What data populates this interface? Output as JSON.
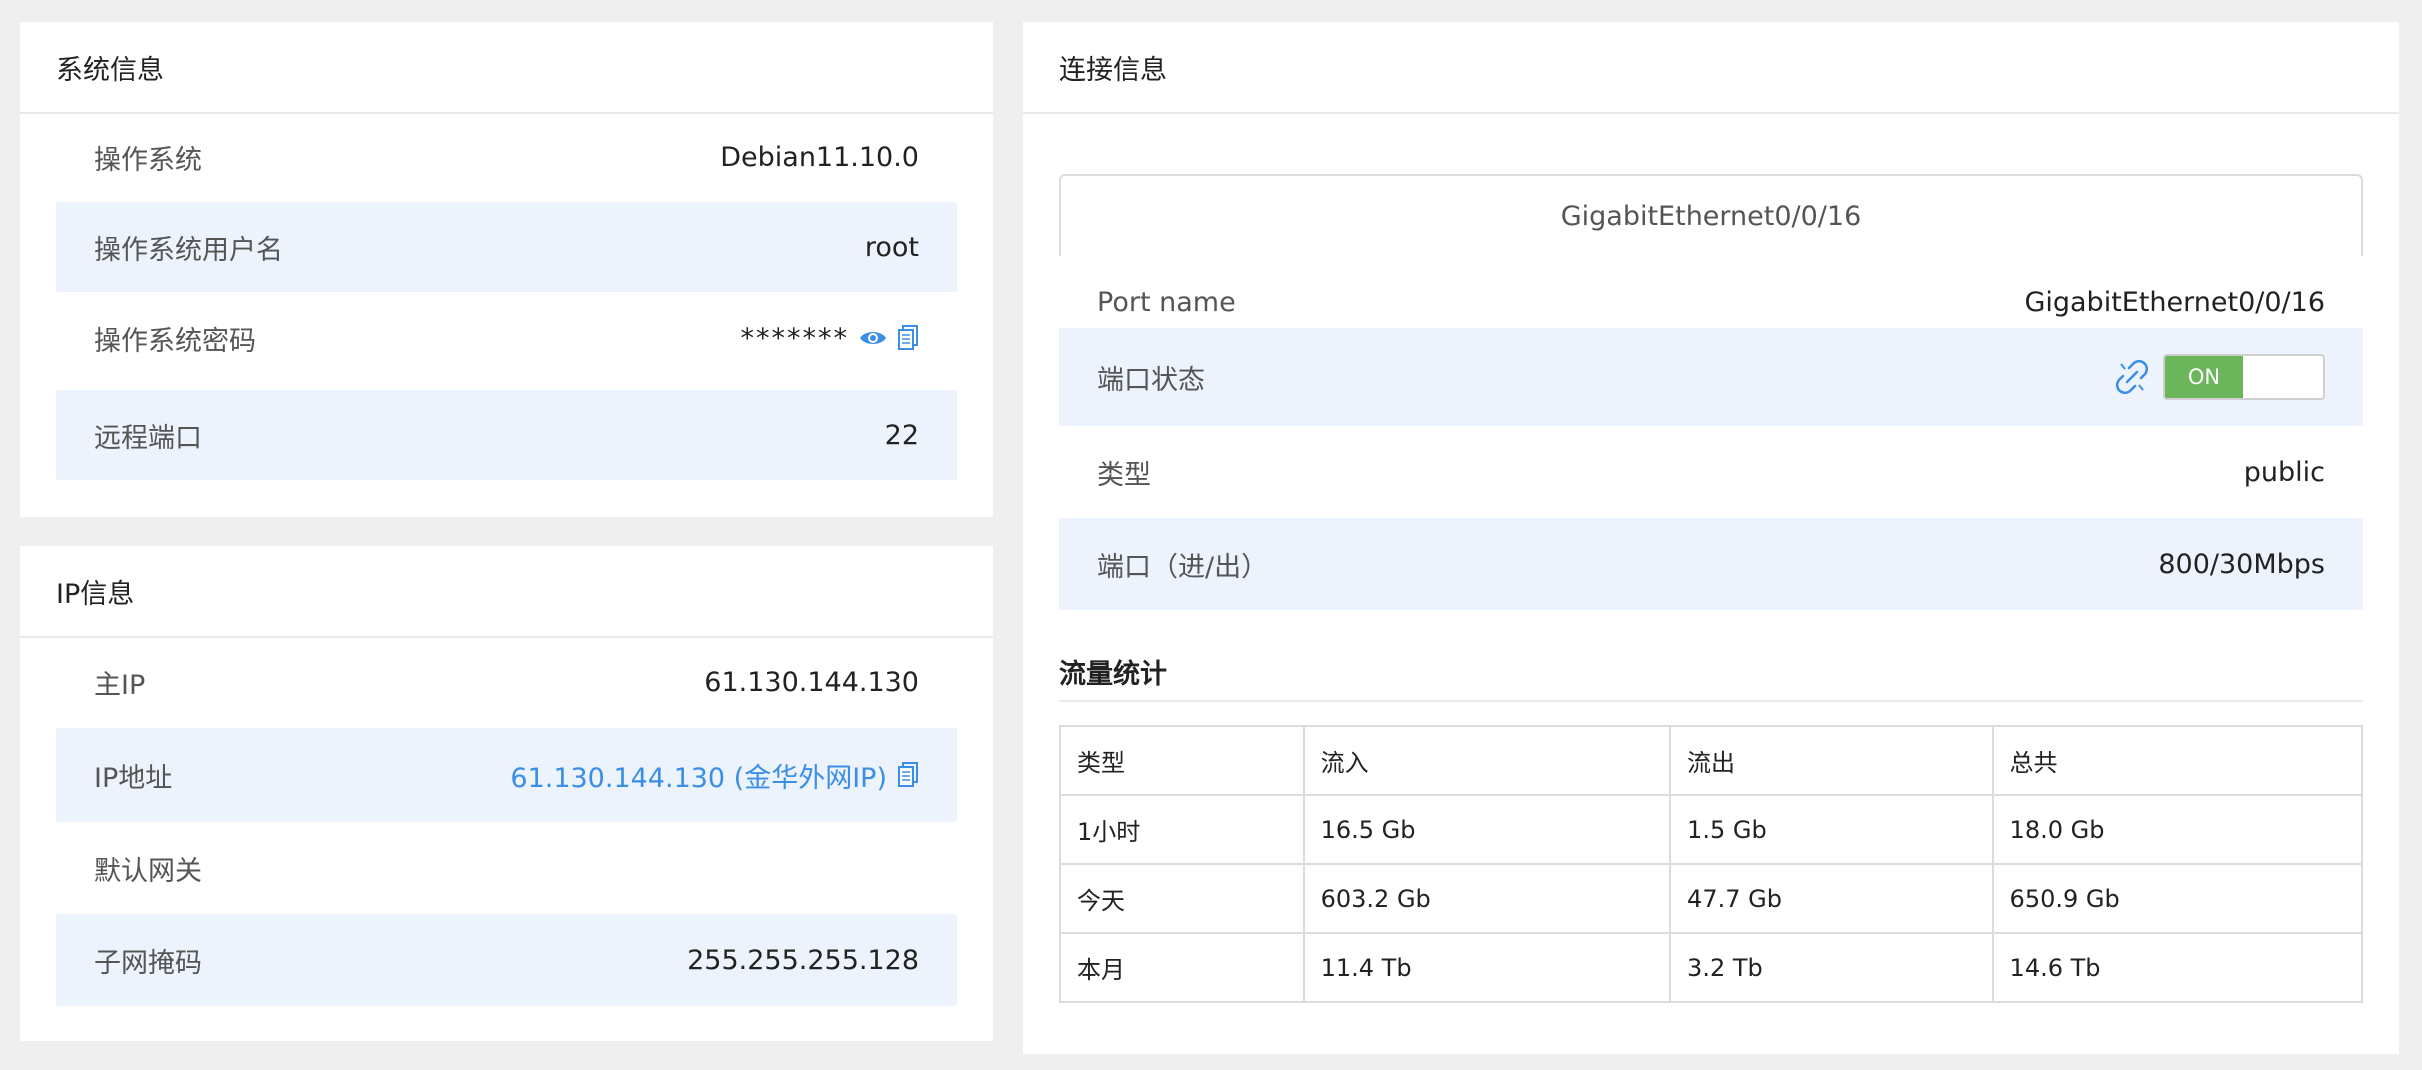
{
  "system_info": {
    "title": "系统信息",
    "rows": [
      {
        "label": "操作系统",
        "value": "Debian11.10.0"
      },
      {
        "label": "操作系统用户名",
        "value": "root"
      },
      {
        "label": "操作系统密码",
        "value": "*******"
      },
      {
        "label": "远程端口",
        "value": "22"
      }
    ]
  },
  "ip_info": {
    "title": "IP信息",
    "rows": [
      {
        "label": "主IP",
        "value": "61.130.144.130"
      },
      {
        "label": "IP地址",
        "value": "61.130.144.130 (金华外网IP)"
      },
      {
        "label": "默认网关",
        "value": ""
      },
      {
        "label": "子网掩码",
        "value": "255.255.255.128"
      }
    ]
  },
  "connection_info": {
    "title": "连接信息",
    "port_tab": "GigabitEthernet0/0/16",
    "rows": [
      {
        "label": "Port name",
        "value": "GigabitEthernet0/0/16"
      },
      {
        "label": "端口状态",
        "toggle_label": "ON"
      },
      {
        "label": "类型",
        "value": "public"
      },
      {
        "label": "端口（进/出）",
        "value": "800/30Mbps"
      }
    ],
    "traffic_title": "流量统计",
    "traffic_table": {
      "headers": [
        "类型",
        "流入",
        "流出",
        "总共"
      ],
      "rows": [
        [
          "1小时",
          "16.5 Gb",
          "1.5 Gb",
          "18.0 Gb"
        ],
        [
          "今天",
          "603.2 Gb",
          "47.7 Gb",
          "650.9 Gb"
        ],
        [
          "本月",
          "11.4 Tb",
          "3.2 Tb",
          "14.6 Tb"
        ]
      ]
    }
  },
  "colors": {
    "accent": "#3a8ee6",
    "row_highlight": "#edf3fd",
    "toggle_on": "#6bb55a"
  }
}
